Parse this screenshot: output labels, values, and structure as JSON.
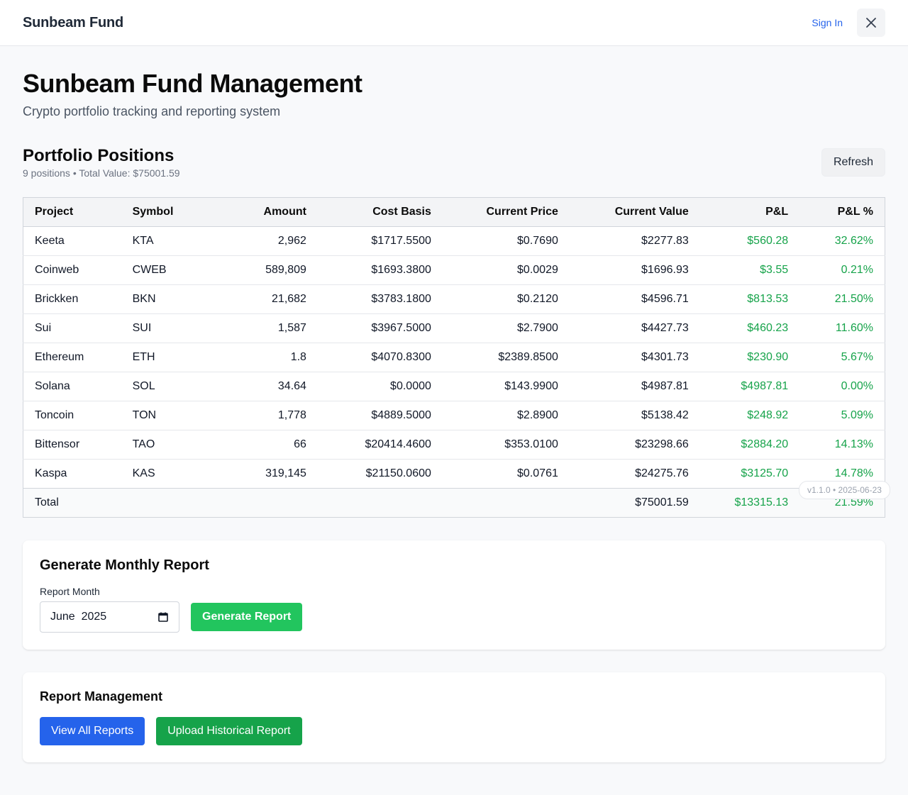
{
  "header": {
    "brand": "Sunbeam Fund",
    "sign_in": "Sign In"
  },
  "page": {
    "title": "Sunbeam Fund Management",
    "subtitle": "Crypto portfolio tracking and reporting system"
  },
  "portfolio": {
    "title": "Portfolio Positions",
    "summary": "9 positions • Total Value: $75001.59",
    "refresh_label": "Refresh",
    "columns": [
      "Project",
      "Symbol",
      "Amount",
      "Cost Basis",
      "Current Price",
      "Current Value",
      "P&L",
      "P&L %"
    ],
    "rows": [
      [
        "Keeta",
        "KTA",
        "2,962",
        "$1717.5500",
        "$0.7690",
        "$2277.83",
        "$560.28",
        "32.62%"
      ],
      [
        "Coinweb",
        "CWEB",
        "589,809",
        "$1693.3800",
        "$0.0029",
        "$1696.93",
        "$3.55",
        "0.21%"
      ],
      [
        "Brickken",
        "BKN",
        "21,682",
        "$3783.1800",
        "$0.2120",
        "$4596.71",
        "$813.53",
        "21.50%"
      ],
      [
        "Sui",
        "SUI",
        "1,587",
        "$3967.5000",
        "$2.7900",
        "$4427.73",
        "$460.23",
        "11.60%"
      ],
      [
        "Ethereum",
        "ETH",
        "1.8",
        "$4070.8300",
        "$2389.8500",
        "$4301.73",
        "$230.90",
        "5.67%"
      ],
      [
        "Solana",
        "SOL",
        "34.64",
        "$0.0000",
        "$143.9900",
        "$4987.81",
        "$4987.81",
        "0.00%"
      ],
      [
        "Toncoin",
        "TON",
        "1,778",
        "$4889.5000",
        "$2.8900",
        "$5138.42",
        "$248.92",
        "5.09%"
      ],
      [
        "Bittensor",
        "TAO",
        "66",
        "$20414.4600",
        "$353.0100",
        "$23298.66",
        "$2884.20",
        "14.13%"
      ],
      [
        "Kaspa",
        "KAS",
        "319,145",
        "$21150.0600",
        "$0.0761",
        "$24275.76",
        "$3125.70",
        "14.78%"
      ]
    ],
    "total": {
      "label": "Total",
      "current_value": "$75001.59",
      "pnl": "$13315.13",
      "pnl_pct": "21.59%"
    },
    "positive_color": "#16a34a"
  },
  "report_gen": {
    "title": "Generate Monthly Report",
    "month_label": "Report Month",
    "month_value": "June  2025",
    "generate_label": "Generate Report"
  },
  "report_mgmt": {
    "title": "Report Management",
    "view_all_label": "View All Reports",
    "upload_label": "Upload Historical Report"
  },
  "version": "v1.1.0 • 2025-06-23"
}
